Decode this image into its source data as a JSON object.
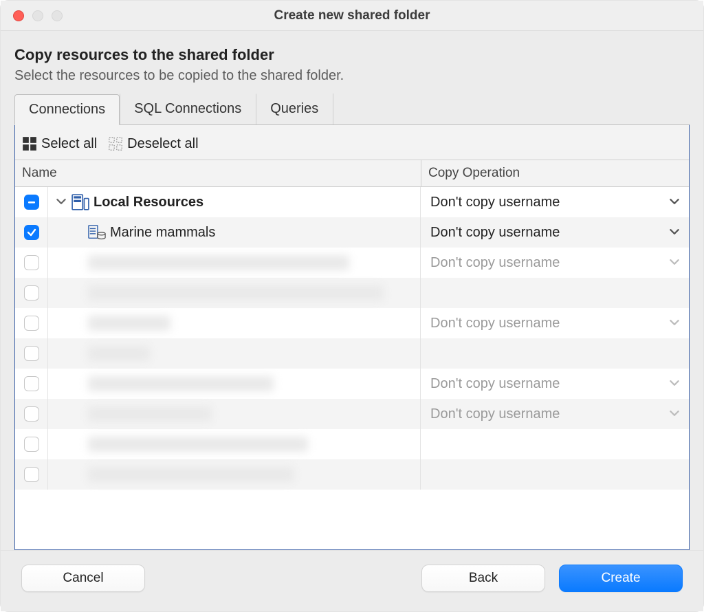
{
  "window": {
    "title": "Create new shared folder"
  },
  "heading": "Copy resources to the shared folder",
  "subheading": "Select the resources to be copied to the shared folder.",
  "tabs": {
    "items": [
      {
        "label": "Connections",
        "active": true
      },
      {
        "label": "SQL Connections",
        "active": false
      },
      {
        "label": "Queries",
        "active": false
      }
    ]
  },
  "toolbar": {
    "select_all": "Select all",
    "deselect_all": "Deselect all"
  },
  "columns": {
    "name": "Name",
    "copy_op": "Copy Operation"
  },
  "copy_option_default": "Don't copy username",
  "rows": [
    {
      "level": 1,
      "check": "mixed",
      "expandable": true,
      "label": "Local Resources",
      "bold": true,
      "icon": "server",
      "op": "Don't copy username",
      "disabled": false
    },
    {
      "level": 2,
      "check": "checked",
      "label": "Marine mammals",
      "icon": "db",
      "op": "Don't copy username",
      "disabled": false,
      "alt": true
    },
    {
      "level": 2,
      "check": "unchecked",
      "blurred": true,
      "blur_w": 380,
      "op": "Don't copy username",
      "disabled": true
    },
    {
      "level": 2,
      "check": "unchecked",
      "blurred": true,
      "blur_w": 430,
      "op": "",
      "disabled": true,
      "alt": true
    },
    {
      "level": 2,
      "check": "unchecked",
      "blurred": true,
      "blur_w": 120,
      "op": "Don't copy username",
      "disabled": true
    },
    {
      "level": 2,
      "check": "unchecked",
      "blurred": true,
      "blur_w": 90,
      "op": "",
      "disabled": true,
      "alt": true
    },
    {
      "level": 2,
      "check": "unchecked",
      "blurred": true,
      "blur_w": 270,
      "op": "Don't copy username",
      "disabled": true
    },
    {
      "level": 2,
      "check": "unchecked",
      "blurred": true,
      "blur_w": 180,
      "op": "Don't copy username",
      "disabled": true,
      "alt": true
    },
    {
      "level": 2,
      "check": "unchecked",
      "blurred": true,
      "blur_w": 320,
      "op": "",
      "disabled": true
    },
    {
      "level": 2,
      "check": "unchecked",
      "blurred": true,
      "blur_w": 300,
      "op": "",
      "disabled": true,
      "alt": true
    }
  ],
  "footer": {
    "cancel": "Cancel",
    "back": "Back",
    "create": "Create"
  }
}
